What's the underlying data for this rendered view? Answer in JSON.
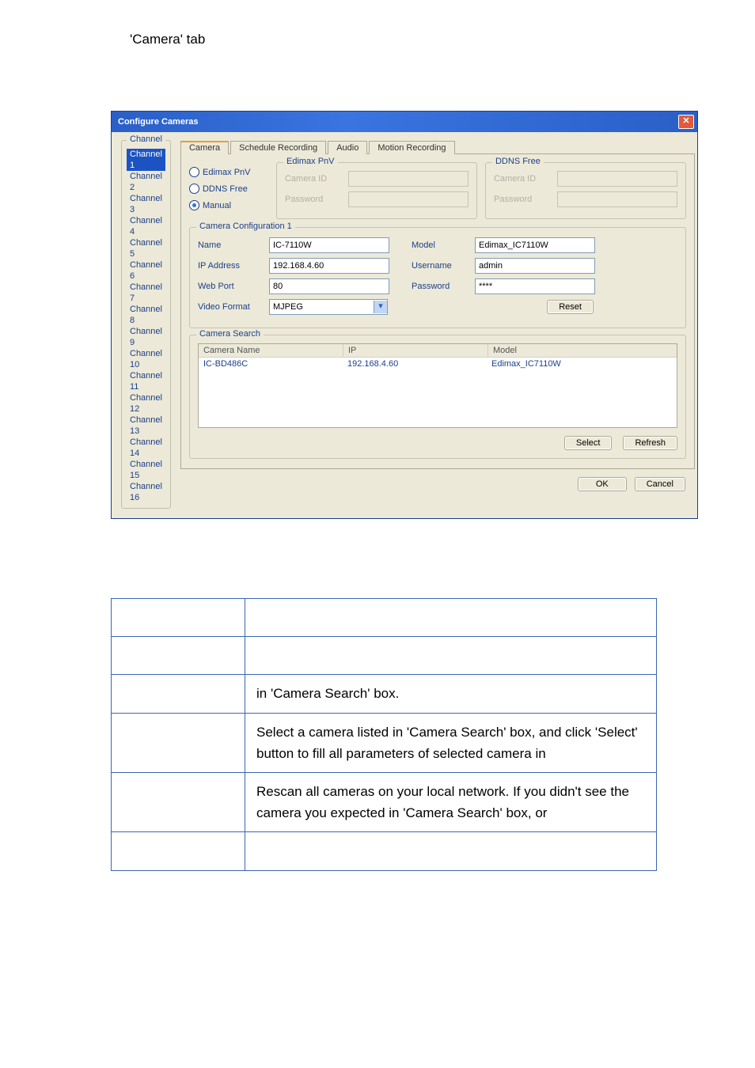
{
  "heading": "'Camera' tab",
  "dialog": {
    "title": "Configure Cameras",
    "channel_group_label": "Channel",
    "channels": [
      "Channel 1",
      "Channel 2",
      "Channel 3",
      "Channel 4",
      "Channel 5",
      "Channel 6",
      "Channel 7",
      "Channel 8",
      "Channel 9",
      "Channel 10",
      "Channel 11",
      "Channel 12",
      "Channel 13",
      "Channel 14",
      "Channel 15",
      "Channel 16"
    ],
    "selected_channel_index": 0,
    "tabs": [
      "Camera",
      "Schedule Recording",
      "Audio",
      "Motion Recording"
    ],
    "active_tab": "Camera",
    "modes": {
      "edimax_pnv": "Edimax PnV",
      "ddns_free": "DDNS Free",
      "manual": "Manual",
      "selected": "Manual"
    },
    "pnv_group": {
      "title": "Edimax PnV",
      "camera_id_label": "Camera ID",
      "password_label": "Password"
    },
    "ddns_group": {
      "title": "DDNS Free",
      "camera_id_label": "Camera ID",
      "password_label": "Password"
    },
    "config_group": {
      "title": "Camera Configuration 1",
      "name_label": "Name",
      "name_value": "IC-7110W",
      "ip_label": "IP Address",
      "ip_value": "192.168.4.60",
      "webport_label": "Web Port",
      "webport_value": "80",
      "videoformat_label": "Video Format",
      "videoformat_value": "MJPEG",
      "model_label": "Model",
      "model_value": "Edimax_IC7110W",
      "username_label": "Username",
      "username_value": "admin",
      "password_label": "Password",
      "password_value": "****",
      "reset_label": "Reset"
    },
    "search_group": {
      "title": "Camera Search",
      "col1": "Camera Name",
      "col2": "IP",
      "col3": "Model",
      "row1": {
        "name": "IC-BD486C",
        "ip": "192.168.4.60",
        "model": "Edimax_IC7110W"
      },
      "select_label": "Select",
      "refresh_label": "Refresh"
    },
    "ok_label": "OK",
    "cancel_label": "Cancel"
  },
  "desc": {
    "r3": "in 'Camera Search' box.",
    "r4": "Select a camera listed in 'Camera Search' box, and click 'Select' button to fill all parameters of selected camera in",
    "r5": "Rescan all cameras on your local network. If you didn't see the camera you expected in 'Camera Search' box, or"
  }
}
